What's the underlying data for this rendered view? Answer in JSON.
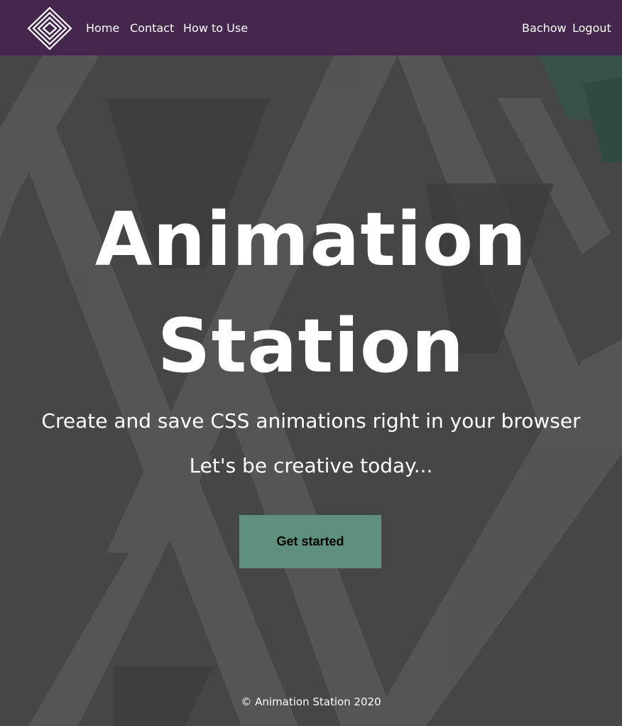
{
  "nav": {
    "logo_icon": "diamond-logo-icon",
    "links": {
      "home": "Home",
      "contact": "Contact",
      "how_to_use": "How to Use",
      "user": "Bachow",
      "logout": "Logout"
    }
  },
  "hero": {
    "title_line1": "Animation",
    "title_line2": "Station",
    "subtitle": "Create and save CSS animations right in your browser",
    "tagline": "Let's be creative today...",
    "cta_label": "Get started"
  },
  "footer": {
    "text": "© Animation Station 2020"
  },
  "colors": {
    "navbar": "#45274e",
    "background": "#474747",
    "button": "#5e917d",
    "text": "#ffffff"
  }
}
